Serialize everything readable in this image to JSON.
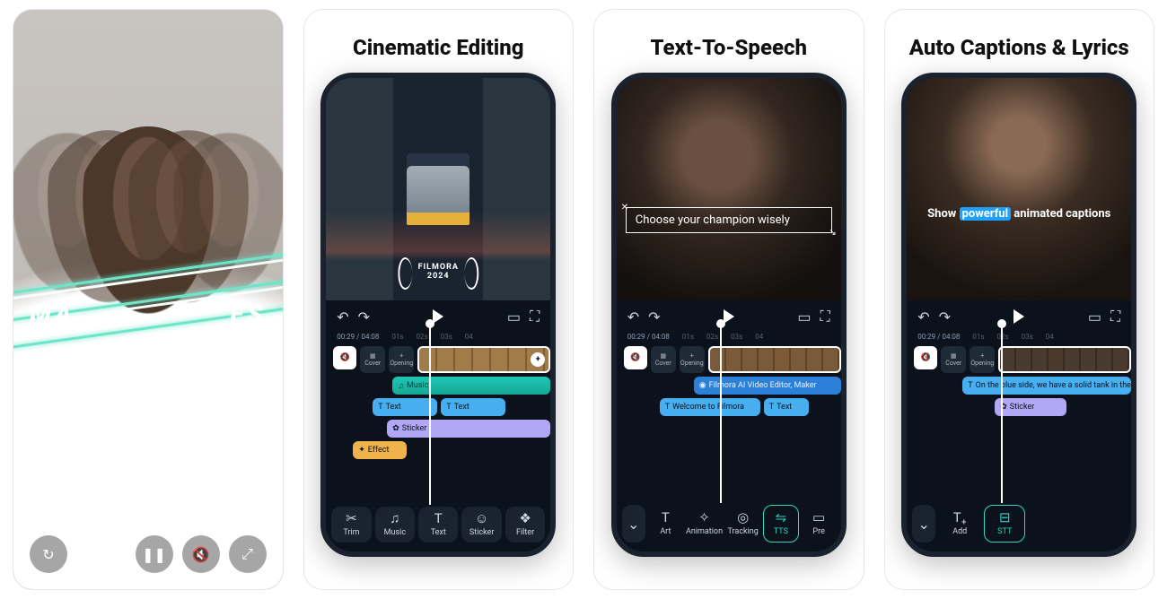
{
  "promo": {
    "text_left": "MA",
    "text_right": "ES",
    "controls": {
      "restart": "↻",
      "pause": "❚❚",
      "mute": "🔇",
      "expand": "⤢"
    }
  },
  "cards": [
    {
      "title": "Cinematic Editing",
      "badge_line1": "FILMORA",
      "badge_line2": "2024",
      "timecode": "00:29 / 04:08",
      "ticks": [
        "01s",
        "02s",
        "03s",
        "04"
      ],
      "mute_icon": "🔇",
      "cover_label": "Cover",
      "opening_label": "Opening",
      "opening_icon": "+",
      "music_label": "Music",
      "text_label": "Text",
      "sticker_label": "Sticker",
      "effect_label": "Effect",
      "toolbar": [
        {
          "icon": "✂",
          "label": "Trim"
        },
        {
          "icon": "♫",
          "label": "Music"
        },
        {
          "icon": "T",
          "label": "Text"
        },
        {
          "icon": "☺",
          "label": "Sticker"
        },
        {
          "icon": "❖",
          "label": "Filter"
        }
      ]
    },
    {
      "title": "Text-To-Speech",
      "caption": "Choose your champion wisely",
      "timecode": "00:29 / 04:08",
      "ticks": [
        "01s",
        "02s",
        "03s",
        "04"
      ],
      "cover_label": "Cover",
      "opening_label": "Opening",
      "opening_icon": "+",
      "tts_clip1": "Filmora AI Video Editor, Maker",
      "tts_clip2": "Welcome to Filmora",
      "tts_clip3": "Text",
      "toolbar": [
        {
          "icon": "T",
          "label": "Art"
        },
        {
          "icon": "✧",
          "label": "Animation"
        },
        {
          "icon": "◎",
          "label": "Tracking"
        },
        {
          "icon": "⇋",
          "label": "TTS"
        },
        {
          "icon": "▭",
          "label": "Pre"
        }
      ],
      "active_index": 3
    },
    {
      "title": "Auto Captions & Lyrics",
      "caption_pre": "Show ",
      "caption_hl": "powerful",
      "caption_post": " animated captions",
      "timecode": "00:29 / 04:08",
      "ticks": [
        "01s",
        "02s",
        "03s",
        "04"
      ],
      "cover_label": "Cover",
      "opening_label": "Opening",
      "opening_icon": "+",
      "caption_clip": "On the blue side,   we have a solid tank in the top",
      "sticker_label": "Sticker",
      "toolbar": [
        {
          "icon": "T₊",
          "label": "Add"
        },
        {
          "icon": "⊟",
          "label": "STT"
        }
      ],
      "active_index": 1
    }
  ]
}
